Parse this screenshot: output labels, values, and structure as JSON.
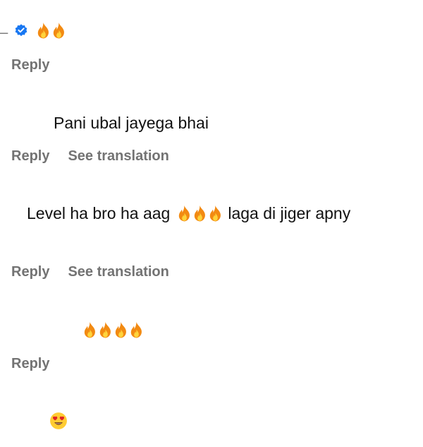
{
  "colors": {
    "fire_outer": "#f28a12",
    "fire_inner": "#ffd43b",
    "verified": "#1877f2",
    "action_text": "#737373",
    "heart_eyes_face": "#ffcc33",
    "heart": "#e02424"
  },
  "icons": {
    "verified": "verified-badge-icon",
    "fire": "fire-emoji",
    "heart_eyes": "heart-eyes-emoji"
  },
  "comments": [
    {
      "username_fragment": "_",
      "fire_count": 2,
      "actions": [
        "Reply"
      ]
    },
    {
      "text": "Pani ubal jayega bhai",
      "actions": [
        "Reply",
        "See translation"
      ]
    },
    {
      "text_before": "Level ha bro ha aag",
      "fire_count": 3,
      "text_after": "laga di jiger apny",
      "actions": [
        "Reply",
        "See translation"
      ]
    },
    {
      "fire_count": 4,
      "actions": [
        "Reply"
      ]
    },
    {
      "emoji": "heart-eyes"
    }
  ]
}
